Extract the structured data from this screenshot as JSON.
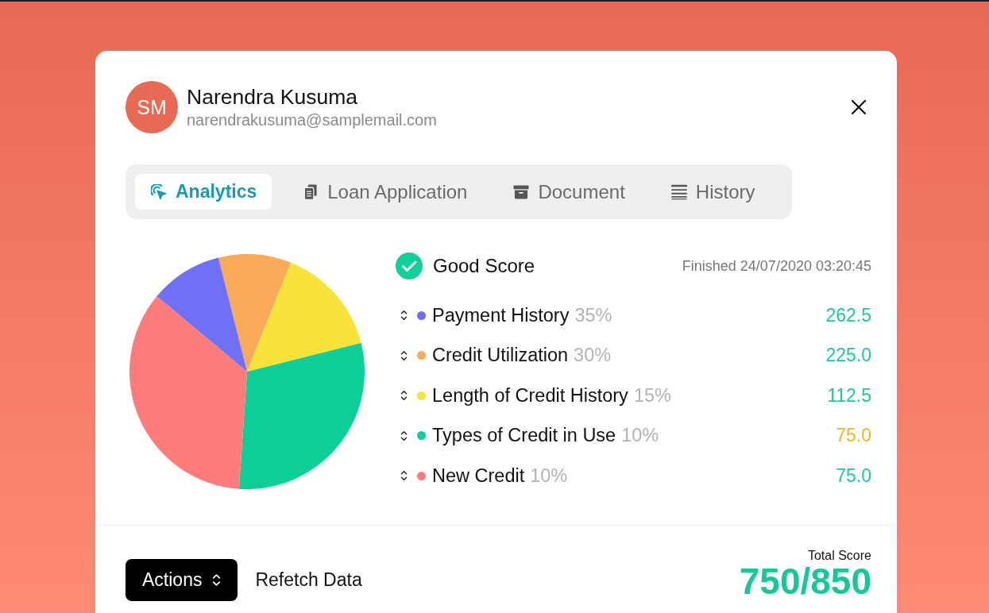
{
  "user": {
    "initials": "SM",
    "name": "Narendra Kusuma",
    "email": "narendrakusuma@samplemail.com"
  },
  "tabs": [
    {
      "label": "Analytics",
      "selected": true
    },
    {
      "label": "Loan Application",
      "selected": false
    },
    {
      "label": "Document",
      "selected": false
    },
    {
      "label": "History",
      "selected": false
    }
  ],
  "analytics": {
    "chart_data": {
      "type": "pie",
      "values": [
        10,
        15,
        30,
        35,
        10
      ],
      "colors": [
        "#fbaa5a",
        "#f8e33b",
        "#0ccf98",
        "#fe7c7c",
        "#6e70f6"
      ]
    },
    "status": "Good Score",
    "finished": "Finished 24/07/2020 03:20:45",
    "factors": [
      {
        "label": "Payment History",
        "weight": "35%",
        "color": "#6e70f6",
        "score": {
          "text": "262.5",
          "color": "#22c79b"
        }
      },
      {
        "label": "Credit Utilization",
        "weight": "30%",
        "color": "#fbaa5a",
        "score": {
          "text": "225.0",
          "color": "#22c79b"
        }
      },
      {
        "label": "Length of Credit History",
        "weight": "15%",
        "color": "#f8e33b",
        "score": {
          "text": "112.5",
          "color": "#22c79b"
        }
      },
      {
        "label": "Types of Credit in Use",
        "weight": "10%",
        "color": "#0ccf98",
        "score": {
          "text": "75.0",
          "color": "#ebb82a"
        }
      },
      {
        "label": "New Credit",
        "weight": "10%",
        "color": "#fe7c7c",
        "score": {
          "text": "75.0",
          "color": "#22c79b"
        }
      }
    ]
  },
  "footer": {
    "actions": "Actions",
    "refetch": "Refetch Data",
    "total_label": "Total Score",
    "total": "750/850"
  }
}
